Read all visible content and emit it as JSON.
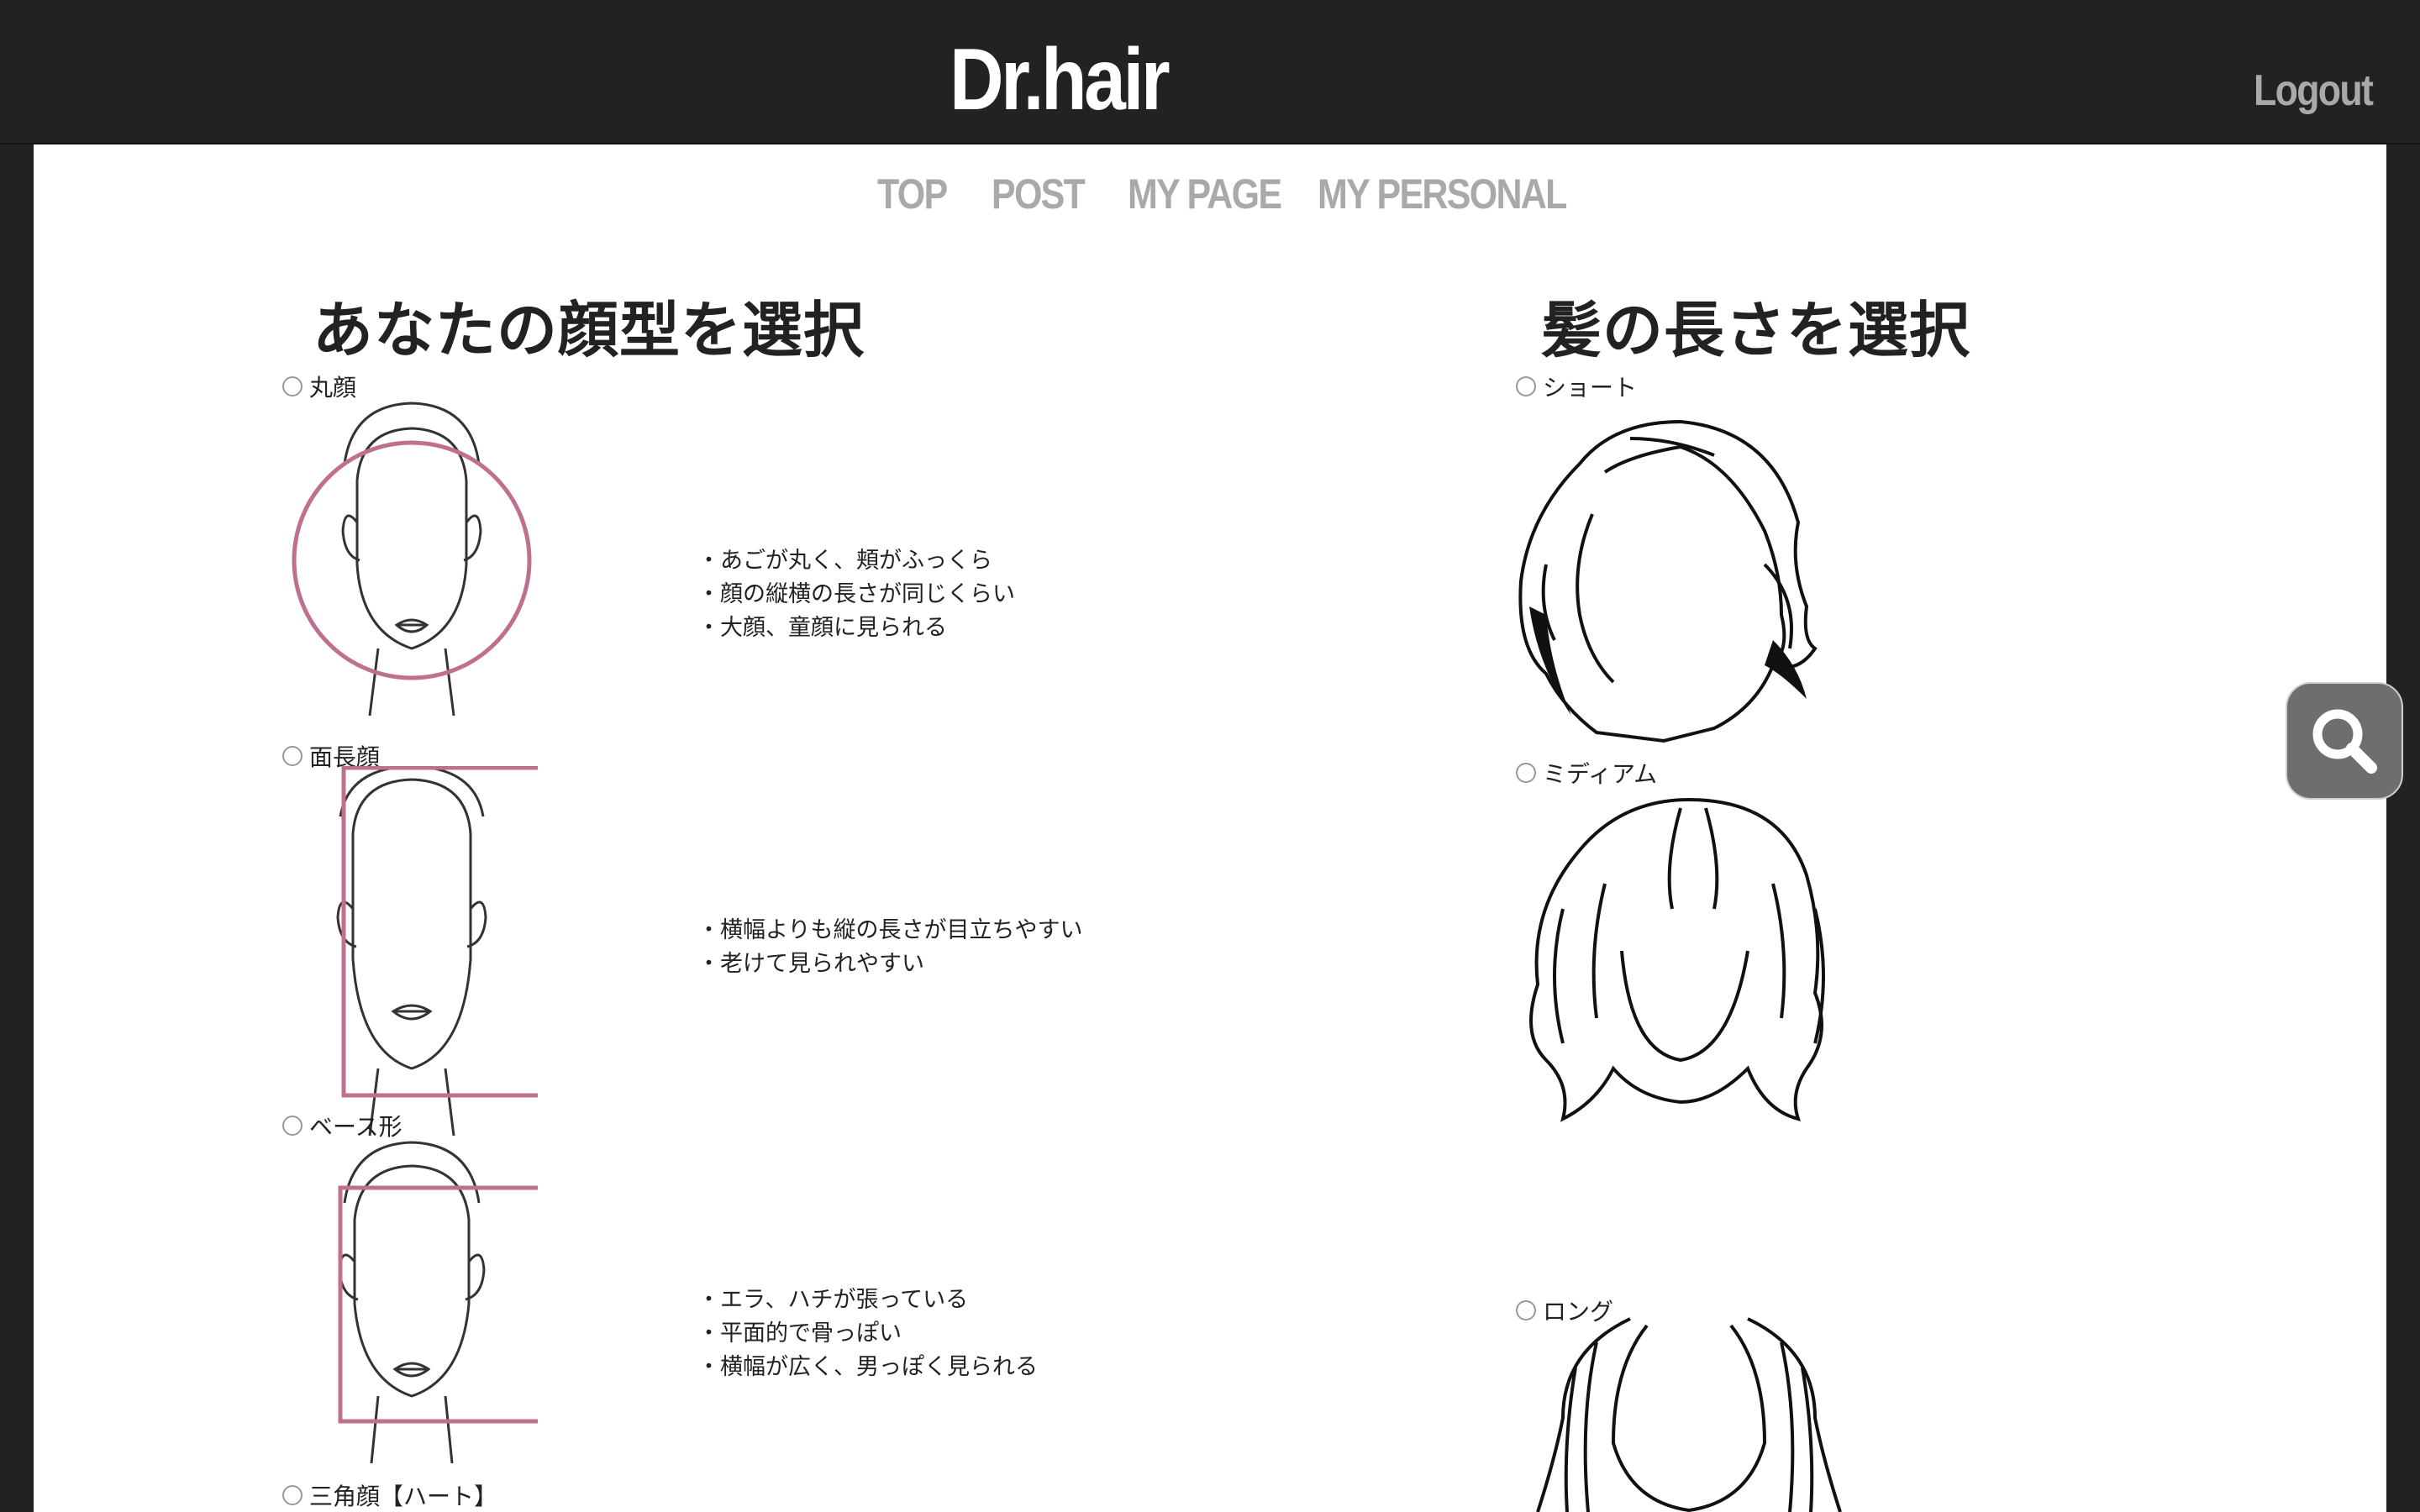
{
  "header": {
    "logo": "Dr.hair",
    "logout_label": "Logout"
  },
  "nav": {
    "items": [
      "TOP",
      "POST",
      "MY PAGE",
      "MY PERSONAL"
    ]
  },
  "face_section": {
    "title": "あなたの顔型を選択",
    "options": [
      {
        "label": "丸顔",
        "bullets": [
          "・あごが丸く、頬がふっくら",
          "・顔の縦横の長さが同じくらい",
          "・大顔、童顔に見られる"
        ]
      },
      {
        "label": "面長顔",
        "bullets": [
          "・横幅よりも縦の長さが目立ちやすい",
          "・老けて見られやすい"
        ]
      },
      {
        "label": "ベース形",
        "bullets": [
          "・エラ、ハチが張っている",
          "・平面的で骨っぽい",
          "・横幅が広く、男っぽく見られる"
        ]
      },
      {
        "label": "三角顔【ハート】"
      }
    ]
  },
  "hair_section": {
    "title": "髪の長さを選択",
    "options": [
      {
        "label": "ショート"
      },
      {
        "label": "ミディアム"
      },
      {
        "label": "ロング"
      }
    ]
  },
  "colors": {
    "header_bg": "#222222",
    "nav_text": "#a9a9a9",
    "face_guide": "#c0708f",
    "search_bg": "#6e6e6e"
  },
  "icons": {
    "search": "search-icon"
  }
}
